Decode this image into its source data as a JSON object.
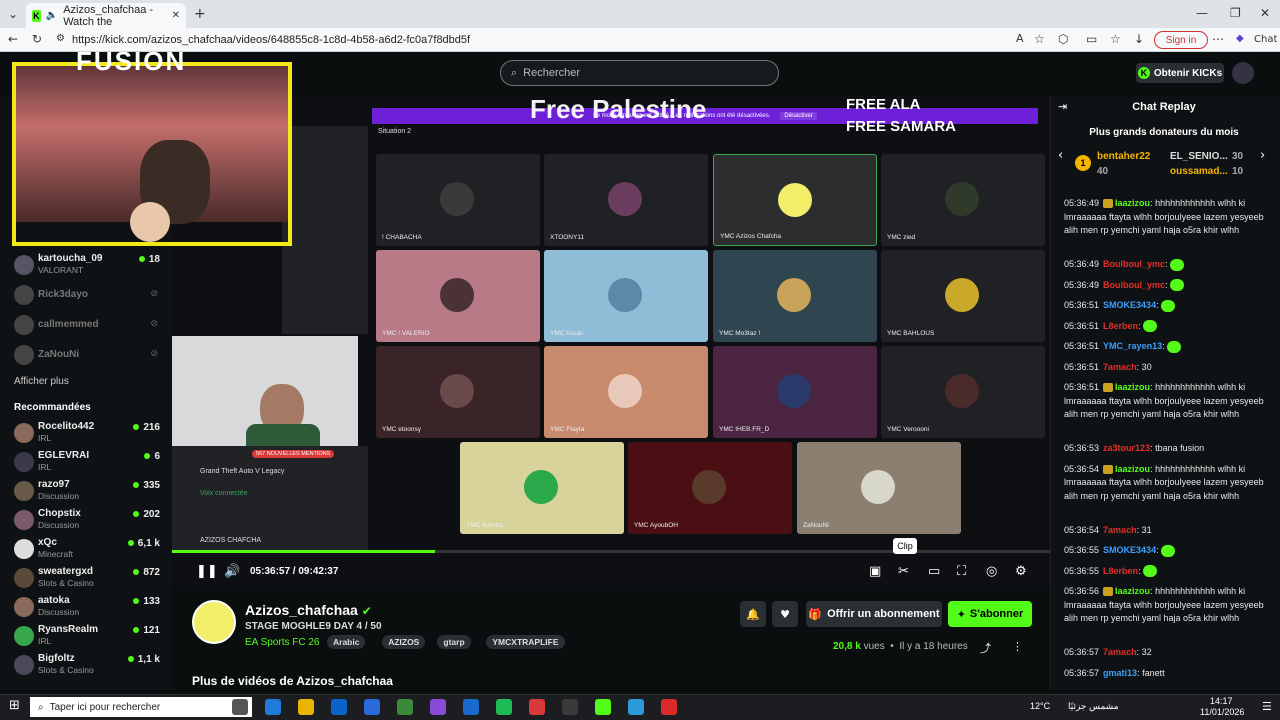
{
  "browser": {
    "tab_title": "Azizos_chafchaa - Watch the",
    "url": "https://kick.com/azizos_chafchaa/videos/648855c8-1c8d-4b58-a6d2-fc0a7f8dbd5f",
    "signin": "Sign in",
    "chat_label": "Chat"
  },
  "header": {
    "search_placeholder": "Rechercher",
    "kicks_button": "Obtenir KICKs"
  },
  "sidebar": {
    "followed": [
      {
        "name": "kartoucha_09",
        "category": "VALORANT",
        "viewers": "18",
        "online": true
      },
      {
        "name": "Rick3dayo",
        "online": false
      },
      {
        "name": "callmemmed",
        "online": false
      },
      {
        "name": "ZaNouNi",
        "online": false
      }
    ],
    "show_more": "Afficher plus",
    "recommended_heading": "Recommandées",
    "recommended": [
      {
        "name": "Rocelito442",
        "category": "IRL",
        "viewers": "216"
      },
      {
        "name": "EGLEVRAI",
        "category": "IRL",
        "viewers": "6"
      },
      {
        "name": "razo97",
        "category": "Discussion",
        "viewers": "335"
      },
      {
        "name": "Chopstix",
        "category": "Discussion",
        "viewers": "202"
      },
      {
        "name": "xQc",
        "category": "Minecraft",
        "viewers": "6,1 k"
      },
      {
        "name": "sweatergxd",
        "category": "Slots & Casino",
        "viewers": "872"
      },
      {
        "name": "aatoka",
        "category": "Discussion",
        "viewers": "133"
      },
      {
        "name": "RyansRealm",
        "category": "IRL",
        "viewers": "121"
      },
      {
        "name": "Bigfoltz",
        "category": "Slots & Casino",
        "viewers": "1,1 k"
      }
    ]
  },
  "video": {
    "overlay_logo": "FUSION",
    "overlay_title": "Free Palestine",
    "overlay_right_1": "FREE ALA",
    "overlay_right_2": "FREE SAMARA",
    "banner_text": "Le mode streamer est activé. Les notifications ont été désactivées.",
    "banner_button": "Désactiver",
    "voice_channel": "Situation 2",
    "game_label": "Grand Theft Auto V Legacy",
    "voice_connected": "Voix connectée",
    "self_name": "AZIZOS CHAFCHA",
    "mentions": "567 NOUVELLES MENTIONS",
    "tiles": [
      {
        "name": "! CHABACHA",
        "bg": "#1f2124",
        "av": "#3a3a3a"
      },
      {
        "name": "XTOONY11",
        "bg": "#1f2124",
        "av": "#6a3d5e"
      },
      {
        "name": "YMC Azizos Chafcha",
        "bg": "#2b2d2e",
        "av": "#f2ee6a"
      },
      {
        "name": "YMC zied",
        "bg": "#1f2124",
        "av": "#2f3a2a"
      },
      {
        "name": "YMC ! VALERIO",
        "bg": "#b77a86",
        "av": "#4a3236"
      },
      {
        "name": "YMC hssan",
        "bg": "#8fbcd6",
        "av": "#5a8aa8"
      },
      {
        "name": "YMC Mo3taz !",
        "bg": "#2f4651",
        "av": "#c9a35a"
      },
      {
        "name": "YMC BAHLOUS",
        "bg": "#1f2124",
        "av": "#c9a82a"
      },
      {
        "name": "YMC etoonsy",
        "bg": "#3a2428",
        "av": "#6a4a4a"
      },
      {
        "name": "YMC Ftayta",
        "bg": "#c88a6c",
        "av": "#e8c8b8"
      },
      {
        "name": "YMC IHEB.FR_D",
        "bg": "#4a2440",
        "av": "#2a3a6a"
      },
      {
        "name": "YMC Veroooni",
        "bg": "#1f2124",
        "av": "#4a2a2a"
      },
      {
        "name": "YMC Bamba",
        "bg": "#d7d39a",
        "av": "#2aa84a"
      },
      {
        "name": "YMC AyoubOH",
        "bg": "#4a0f12",
        "av": "#5a3a2a"
      },
      {
        "name": "ZaNouNi",
        "bg": "#8a7f70",
        "av": "#d8d8c8"
      }
    ],
    "progress_fraction": 0.3
  },
  "player": {
    "time_current": "05:36:57",
    "time_total": "09:42:37",
    "clip_tooltip": "Clip"
  },
  "channel": {
    "name": "Azizos_chafchaa",
    "title": "STAGE MOGHLE9 DAY 4 / 50",
    "game": "EA Sports FC 26",
    "tags": [
      "Arabic",
      "AZIZOS",
      "gtarp",
      "YMCXTRAPLIFE"
    ],
    "subscribe_label": "Offrir un abonnement",
    "follow_label": "S'abonner",
    "views": "20,8 k",
    "views_suffix": "vues",
    "age": "Il y a 18 heures",
    "more_videos": "Plus de vidéos de Azizos_chafchaa"
  },
  "chat": {
    "title": "Chat Replay",
    "donors_title": "Plus grands donateurs du mois",
    "donors": [
      {
        "name": "bentaher22",
        "amount": "40"
      },
      {
        "name": "EL_SENIO...",
        "amount": "30"
      },
      {
        "name": "oussamad...",
        "amount": "10"
      }
    ],
    "messages": [
      {
        "time": "05:36:49",
        "user": "laazizou",
        "color": "#53fc18",
        "text": "hhhhhhhhhhhh wlhh ki lmraaaaaa ftayta wlhh borjoulyeee lazem yesyeeb alih men rp yemchi yaml haja o5ra khir wlhh"
      },
      {
        "time": "05:36:49",
        "user": "Boulboul_ymc",
        "color": "#e0302a",
        "text": ""
      },
      {
        "time": "05:36:49",
        "user": "Boulboul_ymc",
        "color": "#e0302a",
        "text": ""
      },
      {
        "time": "05:36:51",
        "user": "SMOKE3434",
        "color": "#3aa0ff",
        "text": ""
      },
      {
        "time": "05:36:51",
        "user": "L8erben",
        "color": "#e0302a",
        "text": ""
      },
      {
        "time": "05:36:51",
        "user": "YMC_rayen13",
        "color": "#3aa0ff",
        "text": ""
      },
      {
        "time": "05:36:51",
        "user": "7amach",
        "color": "#e0302a",
        "text": "30"
      },
      {
        "time": "05:36:51",
        "user": "laazizou",
        "color": "#53fc18",
        "text": "hhhhhhhhhhhh wlhh ki lmraaaaaa ftayta wlhh borjoulyeee lazem yesyeeb alih men rp yemchi yaml haja o5ra khir wlhh"
      },
      {
        "time": "05:36:53",
        "user": "za3tour123",
        "color": "#e0302a",
        "text": "tbana fusion"
      },
      {
        "time": "05:36:54",
        "user": "laazizou",
        "color": "#53fc18",
        "text": "hhhhhhhhhhhh wlhh ki lmraaaaaa ftayta wlhh borjoulyeee lazem yesyeeb alih men rp yemchi yaml haja o5ra khir wlhh"
      },
      {
        "time": "05:36:54",
        "user": "7amach",
        "color": "#e0302a",
        "text": "31"
      },
      {
        "time": "05:36:55",
        "user": "SMOKE3434",
        "color": "#3aa0ff",
        "text": ""
      },
      {
        "time": "05:36:55",
        "user": "L8erben",
        "color": "#e0302a",
        "text": ""
      },
      {
        "time": "05:36:56",
        "user": "laazizou",
        "color": "#53fc18",
        "text": "hhhhhhhhhhhh wlhh ki lmraaaaaa ftayta wlhh borjoulyeee lazem yesyeeb alih men rp yemchi yaml haja o5ra khir wlhh"
      },
      {
        "time": "05:36:57",
        "user": "7amach",
        "color": "#e0302a",
        "text": "32"
      },
      {
        "time": "05:36:57",
        "user": "gmati13",
        "color": "#3aa0ff",
        "text": "fanett"
      }
    ]
  },
  "taskbar": {
    "search_placeholder": "Taper ici pour rechercher",
    "weather": "12°C",
    "weather_text": "مشمس جزئيًا",
    "time": "14:17",
    "date": "11/01/2026"
  }
}
